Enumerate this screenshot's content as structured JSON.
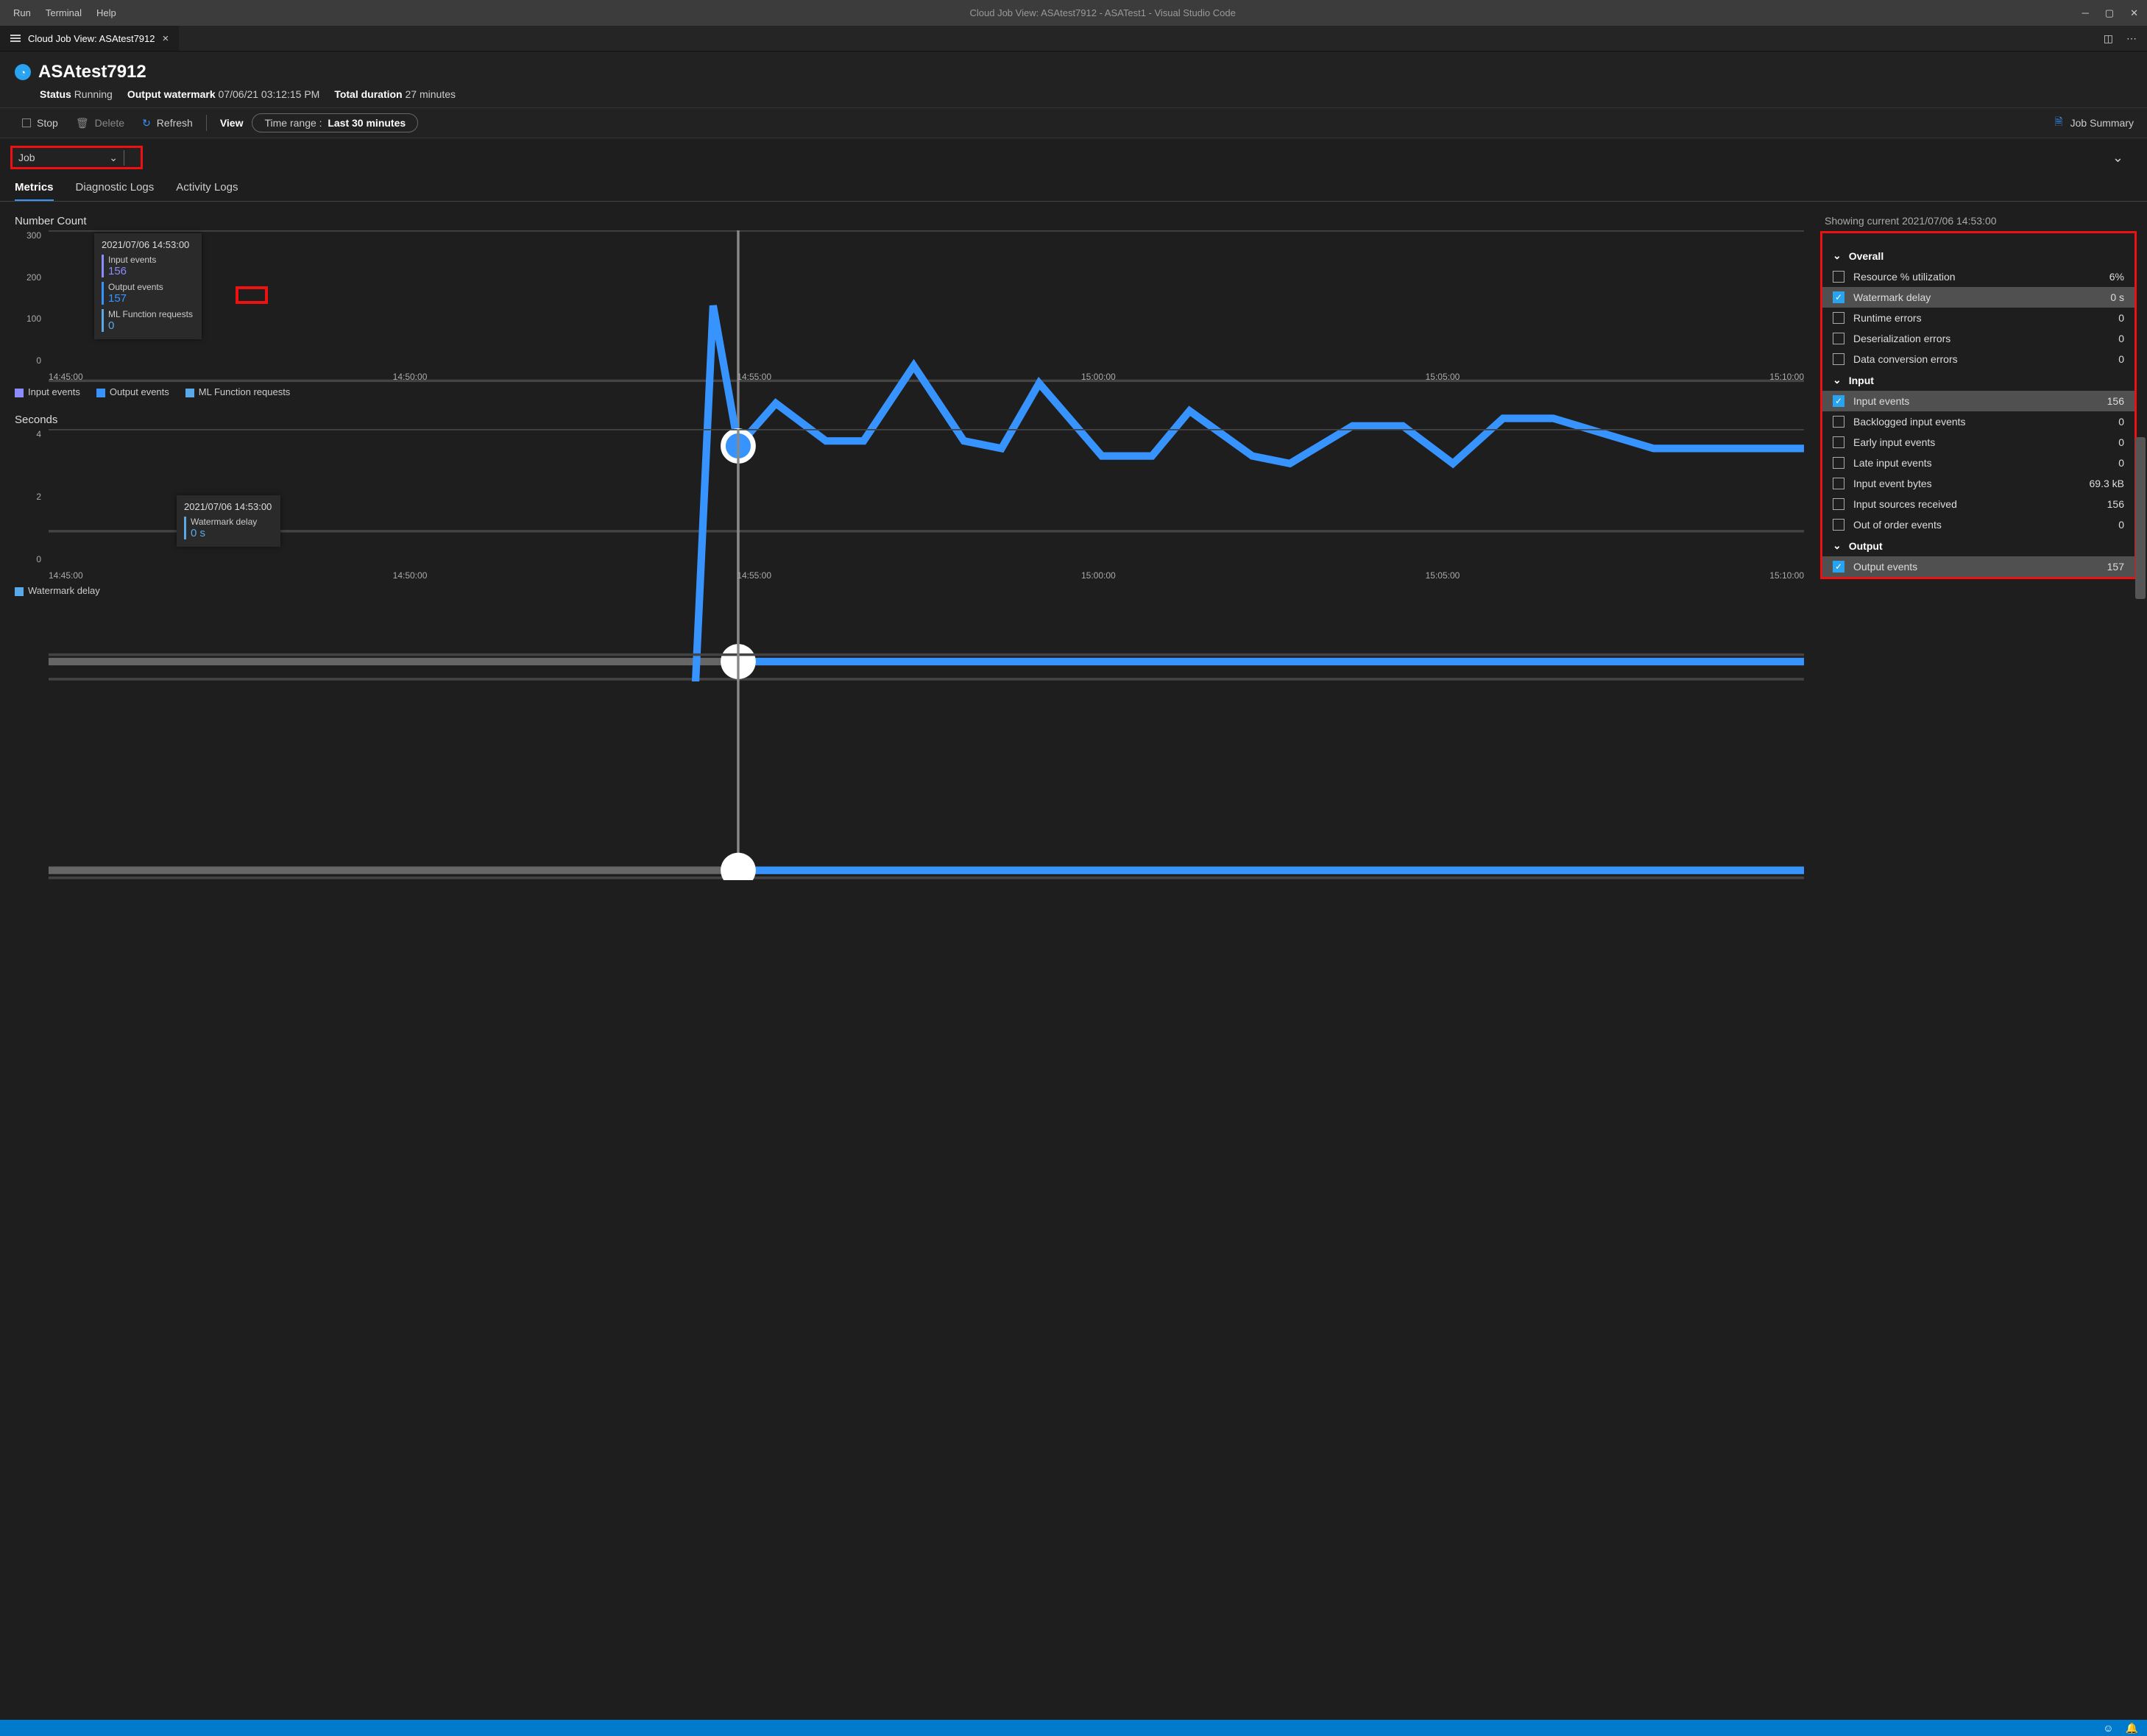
{
  "menubar": {
    "run": "Run",
    "terminal": "Terminal",
    "help": "Help"
  },
  "window_title": "Cloud Job View: ASAtest7912 - ASATest1 - Visual Studio Code",
  "tab": {
    "label": "Cloud Job View: ASAtest7912"
  },
  "job": {
    "name": "ASAtest7912",
    "status_label": "Status",
    "status": "Running",
    "watermark_label": "Output watermark",
    "watermark": "07/06/21 03:12:15 PM",
    "duration_label": "Total duration",
    "duration": "27 minutes"
  },
  "toolbar": {
    "stop": "Stop",
    "delete": "Delete",
    "refresh": "Refresh",
    "view": "View",
    "timerange_label": "Time range :",
    "timerange_value": "Last 30 minutes",
    "summary": "Job Summary"
  },
  "selector": {
    "label": "Job"
  },
  "tabs2": {
    "metrics": "Metrics",
    "diag": "Diagnostic Logs",
    "activity": "Activity Logs"
  },
  "showing_label": "Showing current",
  "showing_time": "2021/07/06 14:53:00",
  "chart1": {
    "title": "Number Count",
    "ylabels": [
      "300",
      "200",
      "100",
      "0"
    ],
    "xlabels": [
      "14:45:00",
      "14:50:00",
      "14:55:00",
      "15:00:00",
      "15:05:00",
      "15:10:00"
    ],
    "legend": [
      {
        "name": "Input events",
        "color": "#8c8cff"
      },
      {
        "name": "Output events",
        "color": "#3794ff"
      },
      {
        "name": "ML Function requests",
        "color": "#5aa9e6"
      }
    ],
    "tooltip": {
      "date": "2021/07/06 14:53:00",
      "rows": [
        {
          "label": "Input events",
          "value": "156"
        },
        {
          "label": "Output events",
          "value": "157"
        },
        {
          "label": "ML Function requests",
          "value": "0"
        }
      ]
    }
  },
  "chart2": {
    "title": "Seconds",
    "ylabels": [
      "4",
      "2",
      "0"
    ],
    "xlabels": [
      "14:45:00",
      "14:50:00",
      "14:55:00",
      "15:00:00",
      "15:05:00",
      "15:10:00"
    ],
    "legend": [
      {
        "name": "Watermark delay",
        "color": "#5aa9e6"
      }
    ],
    "tooltip": {
      "date": "2021/07/06 14:53:00",
      "label": "Watermark delay",
      "value": "0 s"
    }
  },
  "groups": {
    "overall": "Overall",
    "input": "Input",
    "output": "Output"
  },
  "metrics": {
    "overall": [
      {
        "label": "Resource % utilization",
        "value": "6%",
        "checked": false,
        "active": false
      },
      {
        "label": "Watermark delay",
        "value": "0 s",
        "checked": true,
        "active": true
      },
      {
        "label": "Runtime errors",
        "value": "0",
        "checked": false,
        "active": false
      },
      {
        "label": "Deserialization errors",
        "value": "0",
        "checked": false,
        "active": false
      },
      {
        "label": "Data conversion errors",
        "value": "0",
        "checked": false,
        "active": false
      }
    ],
    "input": [
      {
        "label": "Input events",
        "value": "156",
        "checked": true,
        "active": true
      },
      {
        "label": "Backlogged input events",
        "value": "0",
        "checked": false,
        "active": false
      },
      {
        "label": "Early input events",
        "value": "0",
        "checked": false,
        "active": false
      },
      {
        "label": "Late input events",
        "value": "0",
        "checked": false,
        "active": false
      },
      {
        "label": "Input event bytes",
        "value": "69.3 kB",
        "checked": false,
        "active": false
      },
      {
        "label": "Input sources received",
        "value": "156",
        "checked": false,
        "active": false
      },
      {
        "label": "Out of order events",
        "value": "0",
        "checked": false,
        "active": false
      }
    ],
    "output": [
      {
        "label": "Output events",
        "value": "157",
        "checked": true,
        "active": true
      }
    ]
  },
  "chart_data": [
    {
      "type": "line",
      "title": "Number Count",
      "ylabel": "",
      "xlabel": "",
      "xlim": [
        "14:45:00",
        "15:12:00"
      ],
      "ylim": [
        0,
        300
      ],
      "x": [
        "14:51:30",
        "14:52:00",
        "14:53:00",
        "14:54:00",
        "14:55:00",
        "14:56:00",
        "14:57:00",
        "14:58:00",
        "14:59:00",
        "15:00:00",
        "15:01:00",
        "15:02:00",
        "15:03:00",
        "15:04:00",
        "15:05:00",
        "15:06:00",
        "15:07:00",
        "15:08:00",
        "15:09:00",
        "15:10:00",
        "15:11:00"
      ],
      "series": [
        {
          "name": "Input events",
          "values": [
            0,
            250,
            156,
            185,
            160,
            210,
            160,
            155,
            198,
            150,
            150,
            180,
            150,
            145,
            170,
            170,
            145,
            175,
            175,
            155,
            155
          ]
        },
        {
          "name": "Output events",
          "values": [
            0,
            250,
            157,
            185,
            160,
            210,
            160,
            155,
            198,
            150,
            150,
            180,
            150,
            145,
            170,
            170,
            145,
            175,
            175,
            155,
            155
          ]
        },
        {
          "name": "ML Function requests",
          "values": [
            0,
            0,
            0,
            0,
            0,
            0,
            0,
            0,
            0,
            0,
            0,
            0,
            0,
            0,
            0,
            0,
            0,
            0,
            0,
            0,
            0
          ]
        }
      ]
    },
    {
      "type": "line",
      "title": "Seconds",
      "ylabel": "",
      "xlabel": "",
      "xlim": [
        "14:45:00",
        "15:12:00"
      ],
      "ylim": [
        0,
        4
      ],
      "x": [
        "14:51:30",
        "14:53:00",
        "15:11:00"
      ],
      "series": [
        {
          "name": "Watermark delay",
          "values": [
            0,
            0,
            0
          ]
        }
      ]
    }
  ]
}
